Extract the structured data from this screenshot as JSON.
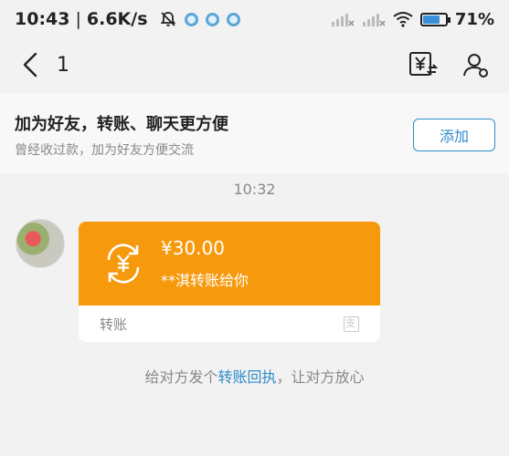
{
  "status_bar": {
    "time": "10:43",
    "separator": "|",
    "network_speed": "6.6K/s",
    "battery_percent": "71%",
    "battery_level": 0.71,
    "icons": [
      "mute-bell-icon",
      "notification-dot-icon",
      "notification-dot-icon",
      "notification-dot-icon",
      "signal-icon",
      "signal-icon",
      "wifi-icon",
      "battery-icon"
    ]
  },
  "nav": {
    "title": "1",
    "icons": [
      "back-arrow-icon",
      "transfer-yuan-icon",
      "user-profile-icon"
    ]
  },
  "friend_banner": {
    "title": "加为好友，转账、聊天更方便",
    "subtitle": "曾经收过款，加为好友方便交流",
    "add_button": "添加"
  },
  "chat": {
    "timestamp": "10:32",
    "transfer": {
      "amount": "¥30.00",
      "description": "**淇转账给你",
      "label": "转账",
      "icons": [
        "transfer-yuan-icon",
        "alipay-brand-icon"
      ]
    },
    "receipt_hint": {
      "prefix": "给对方发个",
      "link": "转账回执",
      "suffix": "，让对方放心"
    }
  },
  "colors": {
    "accent_blue": "#2f8bcb",
    "transfer_orange": "#f7990c",
    "background": "#f2f2f2"
  }
}
